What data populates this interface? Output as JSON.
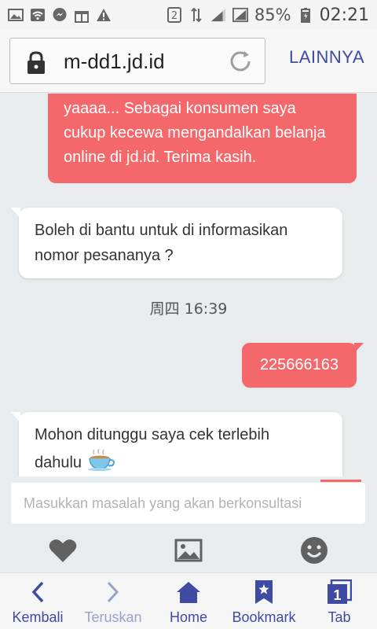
{
  "status_bar": {
    "sim_badge": "2",
    "battery_percent": "85%",
    "time": "02:21"
  },
  "address_bar": {
    "url": "m-dd1.jd.id",
    "more_label": "LAINNYA"
  },
  "chat": {
    "messages": [
      {
        "side": "out",
        "text_lines": [
          "yaaaa... Sebagai konsumen saya",
          "cukup kecewa mengandalkan belanja",
          "online di jd.id. Terima kasih."
        ]
      },
      {
        "side": "in",
        "text_lines": [
          "Boleh di bantu untuk di informasikan",
          "nomor pesananya ?"
        ]
      },
      {
        "side": "timestamp",
        "text": "周四 16:39"
      },
      {
        "side": "out",
        "text": "225666163"
      },
      {
        "side": "in",
        "text_lines": [
          "Mohon ditunggu saya cek terlebih",
          "dahulu"
        ]
      }
    ]
  },
  "input": {
    "placeholder": "Masukkan masalah yang akan berkonsultasi"
  },
  "tools": [
    "heart-icon",
    "image-icon",
    "smiley-icon"
  ],
  "bottom_nav": {
    "back": "Kembali",
    "forward": "Teruskan",
    "home": "Home",
    "bookmark": "Bookmark",
    "tab": "Tab",
    "tab_count": "1"
  },
  "colors": {
    "accent_red": "#f4676a",
    "nav_blue": "#3f4aa3"
  }
}
